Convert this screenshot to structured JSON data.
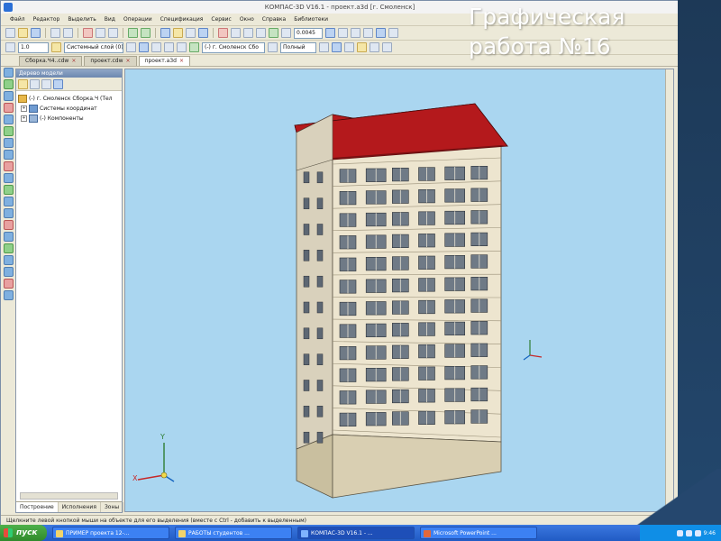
{
  "window": {
    "title": "КОМПАС-3D V16.1 - проект.a3d [г. Смоленск]"
  },
  "menu": [
    "Файл",
    "Редактор",
    "Выделить",
    "Вид",
    "Операции",
    "Спецификация",
    "Сервис",
    "Окно",
    "Справка",
    "Библиотеки"
  ],
  "toolbar": {
    "scale_value": "1.0",
    "layer_value": "Системный слой (0)",
    "object_value": "(-) г. Смоленск Сбо",
    "view_mode": "Полный",
    "step_value": "0.0045"
  },
  "tabs": [
    {
      "label": "Сборка.Ч4..cdw"
    },
    {
      "label": "проект.cdw"
    },
    {
      "label": "проект.a3d"
    }
  ],
  "tree_panel": {
    "title": "Дерево модели",
    "items": [
      "(-) г. Смоленск Сборка.Ч (Тел",
      "Системы координат",
      "(-) Компоненты"
    ],
    "bottom_tabs": [
      "Построение",
      "Исполнения",
      "Зоны"
    ]
  },
  "status_text": "Щелкните левой кнопкой мыши на объекте для его выделения (вместе с Ctrl - добавить к выделенным)",
  "taskbar": {
    "start_label": "пуск",
    "tasks": [
      "ПРИМЕР проекта 12-...",
      "РАБОТЫ студентов ...",
      "КОМПАС-3D V16.1 - ...",
      "Microsoft PowerPoint ..."
    ],
    "clock": "9:46"
  },
  "slide_title": [
    "Графическая",
    "работа №16"
  ],
  "colors": {
    "viewport_bg": "#aad6f0",
    "roof": "#b4191c",
    "facade": "#ede5cf",
    "plinth": "#d9cfb2",
    "slide_bg": "#1f3a5a"
  },
  "axis_labels": {
    "x": "X",
    "y": "Y"
  }
}
